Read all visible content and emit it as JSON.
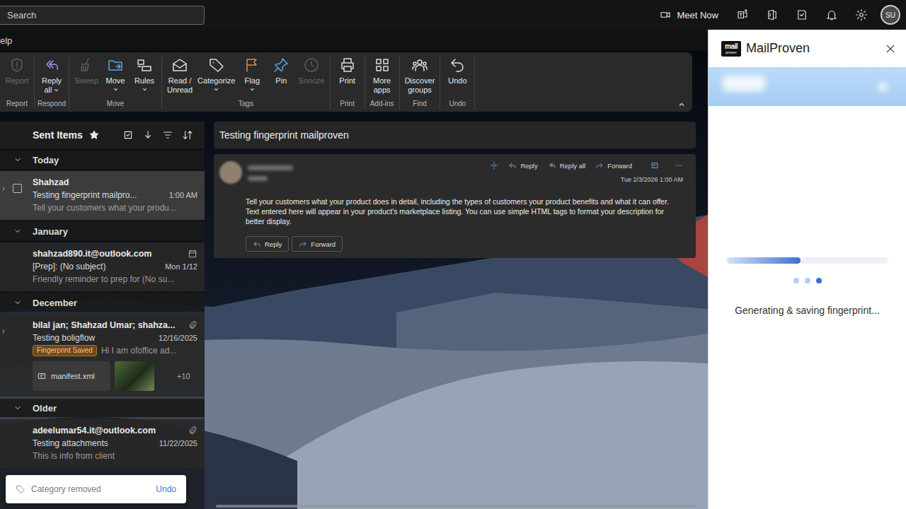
{
  "top_bar": {
    "search_placeholder": "Search",
    "meet_now": "Meet Now",
    "avatar_initials": "SU"
  },
  "tab_strip": {
    "visible_tab": "elp"
  },
  "ribbon": {
    "expanded": true,
    "groups": [
      {
        "label": "Report",
        "buttons": [
          {
            "lines": [
              "Report"
            ],
            "disabled": true,
            "dropdown": false
          }
        ]
      },
      {
        "label": "Respond",
        "buttons": [
          {
            "lines": [
              "Reply",
              "all"
            ],
            "disabled": false,
            "dropdown": true
          }
        ]
      },
      {
        "label": "Move",
        "buttons": [
          {
            "lines": [
              "Sweep"
            ],
            "disabled": true,
            "dropdown": false
          },
          {
            "lines": [
              "Move"
            ],
            "disabled": false,
            "dropdown": true
          },
          {
            "lines": [
              "Rules"
            ],
            "disabled": false,
            "dropdown": true
          }
        ]
      },
      {
        "label": "Tags",
        "buttons": [
          {
            "lines": [
              "Read /",
              "Unread"
            ],
            "disabled": false,
            "dropdown": false
          },
          {
            "lines": [
              "Categorize"
            ],
            "disabled": false,
            "dropdown": true
          },
          {
            "lines": [
              "Flag"
            ],
            "disabled": false,
            "dropdown": true
          },
          {
            "lines": [
              "Pin"
            ],
            "disabled": false,
            "dropdown": false
          },
          {
            "lines": [
              "Snooze"
            ],
            "disabled": true,
            "dropdown": false
          }
        ]
      },
      {
        "label": "Print",
        "buttons": [
          {
            "lines": [
              "Print"
            ],
            "disabled": false,
            "dropdown": false
          }
        ]
      },
      {
        "label": "Add-ins",
        "buttons": [
          {
            "lines": [
              "More",
              "apps"
            ],
            "disabled": false,
            "dropdown": false
          }
        ]
      },
      {
        "label": "Find",
        "buttons": [
          {
            "lines": [
              "Discover",
              "groups"
            ],
            "disabled": false,
            "dropdown": false
          }
        ]
      },
      {
        "label": "Undo",
        "buttons": [
          {
            "lines": [
              "Undo"
            ],
            "disabled": false,
            "dropdown": false
          }
        ]
      }
    ]
  },
  "message_list": {
    "folder": "Sent Items",
    "favorite": true,
    "groups": [
      {
        "label": "Today",
        "expanded": true,
        "items": [
          {
            "sender": "Shahzad",
            "subject": "Testing fingerprint mailpro...",
            "date": "1:00 AM",
            "preview": "Tell your customers what your produ...",
            "selected": true,
            "checked": false,
            "conversation": true,
            "calendar": false,
            "attachment": false,
            "tags": [],
            "attachments": []
          }
        ]
      },
      {
        "label": "January",
        "expanded": true,
        "items": [
          {
            "sender": "shahzad890.it@outlook.com",
            "subject": "[Prep]: (No subject)",
            "date": "Mon 1/12",
            "preview": "Friendly reminder to prep for (No su...",
            "selected": false,
            "checked": false,
            "conversation": false,
            "calendar": true,
            "attachment": false,
            "tags": [],
            "attachments": []
          }
        ]
      },
      {
        "label": "December",
        "expanded": true,
        "items": [
          {
            "sender": "bilal jan; Shahzad Umar; shahza...",
            "subject": "Testing boligflow",
            "date": "12/16/2025",
            "preview": "Hi I am ofoffice ad...",
            "selected": false,
            "checked": false,
            "conversation": true,
            "calendar": false,
            "attachment": true,
            "tags": [
              {
                "label": "Fingerprint Saved"
              }
            ],
            "attachments": [
              {
                "kind": "file",
                "name": "manifest.xml"
              },
              {
                "kind": "image",
                "name": ""
              }
            ],
            "more_attachments": "+10"
          }
        ]
      },
      {
        "label": "Older",
        "expanded": true,
        "items": [
          {
            "sender": "adeelumar54.it@outlook.com",
            "subject": "Testing attachments",
            "date": "11/22/2025",
            "preview": "This is info from client",
            "selected": false,
            "checked": false,
            "conversation": false,
            "calendar": false,
            "attachment": true,
            "tags": [],
            "attachments": []
          }
        ]
      }
    ]
  },
  "reading_pane": {
    "subject": "Testing fingerprint mailproven",
    "message": {
      "actions": [
        {
          "label": "Reply"
        },
        {
          "label": "Reply all"
        },
        {
          "label": "Forward"
        }
      ],
      "date": "Tue 2/3/2026 1:00 AM",
      "body": "Tell your customers what your product does in detail, including the types of customers your product benefits and what it can offer. Text entered here will appear in your product's marketplace listing. You can use simple HTML tags to format your description for better display.",
      "buttons": [
        {
          "label": "Reply"
        },
        {
          "label": "Forward"
        }
      ]
    }
  },
  "toast": {
    "text": "Category removed",
    "action": "Undo"
  },
  "addin": {
    "logo": {
      "top": "mail",
      "bottom": "proven"
    },
    "title": "MailProven",
    "progress": {
      "level": 0.46
    },
    "dots": [
      {
        "active": false
      },
      {
        "active": false
      },
      {
        "active": true
      }
    ],
    "status": "Generating & saving fingerprint..."
  }
}
